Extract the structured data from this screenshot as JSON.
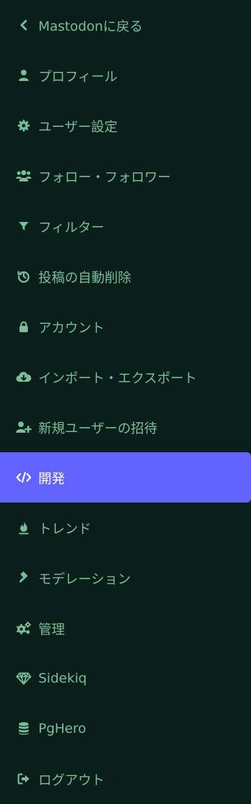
{
  "menu": {
    "items": [
      {
        "label": "Mastodonに戻る",
        "icon": "chevron-left-icon"
      },
      {
        "label": "プロフィール",
        "icon": "user-icon"
      },
      {
        "label": "ユーザー設定",
        "icon": "gear-icon"
      },
      {
        "label": "フォロー・フォロワー",
        "icon": "users-icon"
      },
      {
        "label": "フィルター",
        "icon": "filter-icon"
      },
      {
        "label": "投稿の自動削除",
        "icon": "history-icon"
      },
      {
        "label": "アカウント",
        "icon": "lock-icon"
      },
      {
        "label": "インポート・エクスポート",
        "icon": "cloud-download-icon"
      },
      {
        "label": "新規ユーザーの招待",
        "icon": "user-plus-icon"
      },
      {
        "label": "開発",
        "icon": "code-icon",
        "active": true
      },
      {
        "label": "トレンド",
        "icon": "fire-icon"
      },
      {
        "label": "モデレーション",
        "icon": "gavel-icon"
      },
      {
        "label": "管理",
        "icon": "cogs-icon"
      },
      {
        "label": "Sidekiq",
        "icon": "diamond-icon"
      },
      {
        "label": "PgHero",
        "icon": "database-icon"
      },
      {
        "label": "ログアウト",
        "icon": "sign-out-icon"
      }
    ]
  },
  "colors": {
    "background": "#0a1f19",
    "text": "#79bd9a",
    "active_background": "#6364ff",
    "active_text": "#ffffff"
  }
}
